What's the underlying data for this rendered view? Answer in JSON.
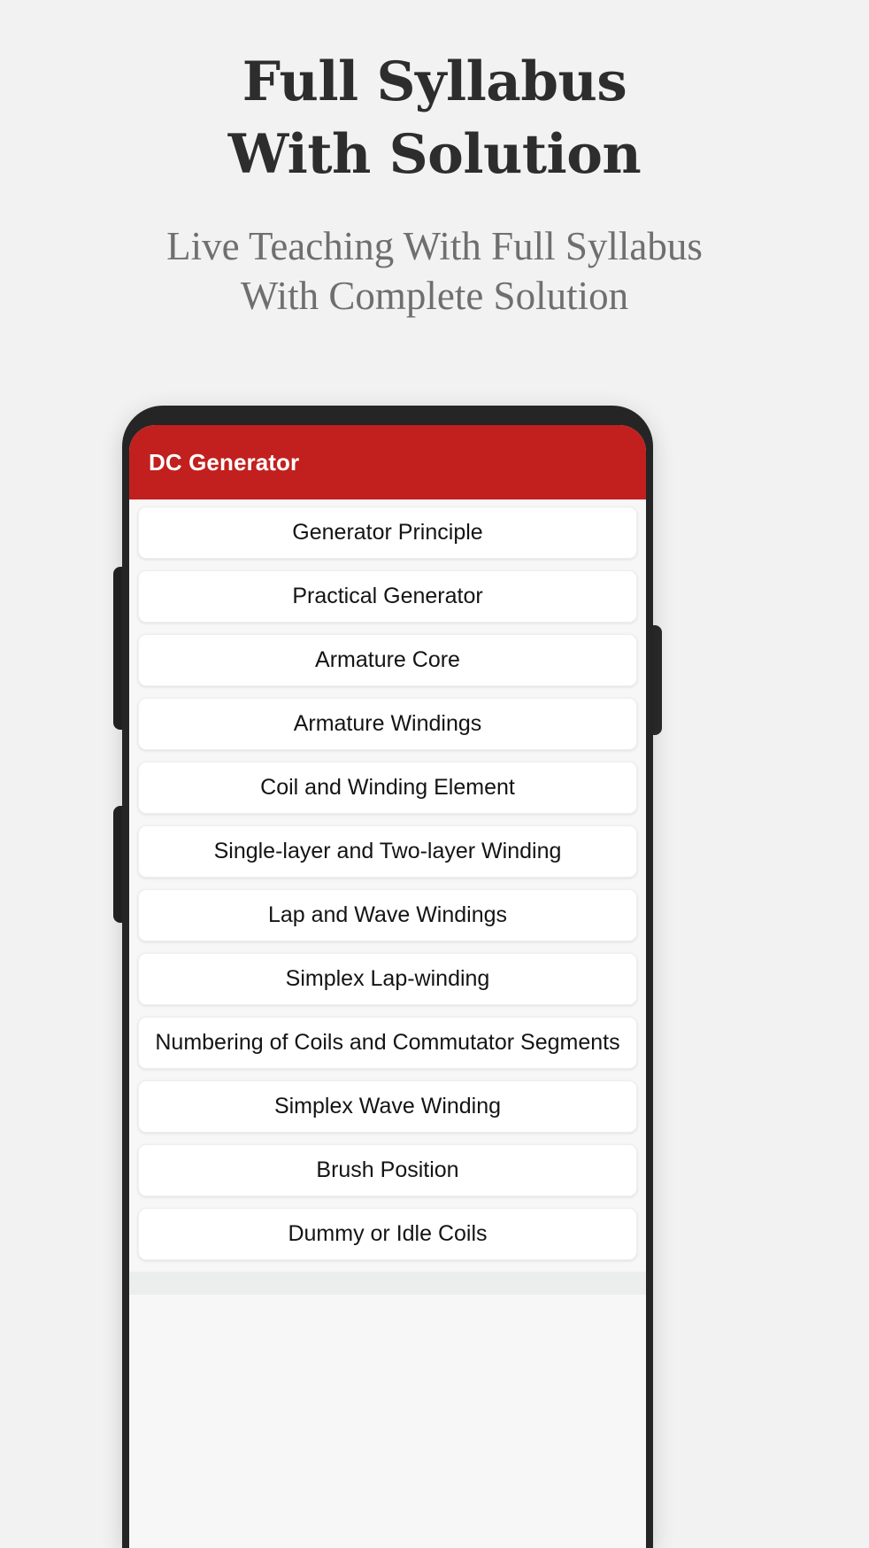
{
  "promo": {
    "title_line1": "Full Syllabus",
    "title_line2": "With Solution",
    "subtitle_line1": "Live Teaching With Full Syllabus",
    "subtitle_line2": "With Complete Solution",
    "title_color": "#2d2d2d",
    "subtitle_color": "#6f6f6f",
    "background_color": "#f2f2f2"
  },
  "app": {
    "appbar": {
      "title": "DC Generator",
      "background_color": "#c1201e",
      "text_color": "#ffffff"
    },
    "list": {
      "background_color": "#f7f7f7",
      "items": [
        {
          "label": "Generator Principle"
        },
        {
          "label": "Practical Generator"
        },
        {
          "label": "Armature Core"
        },
        {
          "label": "Armature Windings"
        },
        {
          "label": "Coil and Winding Element"
        },
        {
          "label": "Single-layer and Two-layer Winding"
        },
        {
          "label": "Lap and Wave Windings"
        },
        {
          "label": "Simplex Lap-winding"
        },
        {
          "label": "Numbering of Coils and Commutator Segments"
        },
        {
          "label": "Simplex Wave Winding"
        },
        {
          "label": "Brush Position"
        },
        {
          "label": "Dummy or Idle Coils"
        }
      ]
    },
    "device": {
      "frame_color": "#252525"
    }
  }
}
